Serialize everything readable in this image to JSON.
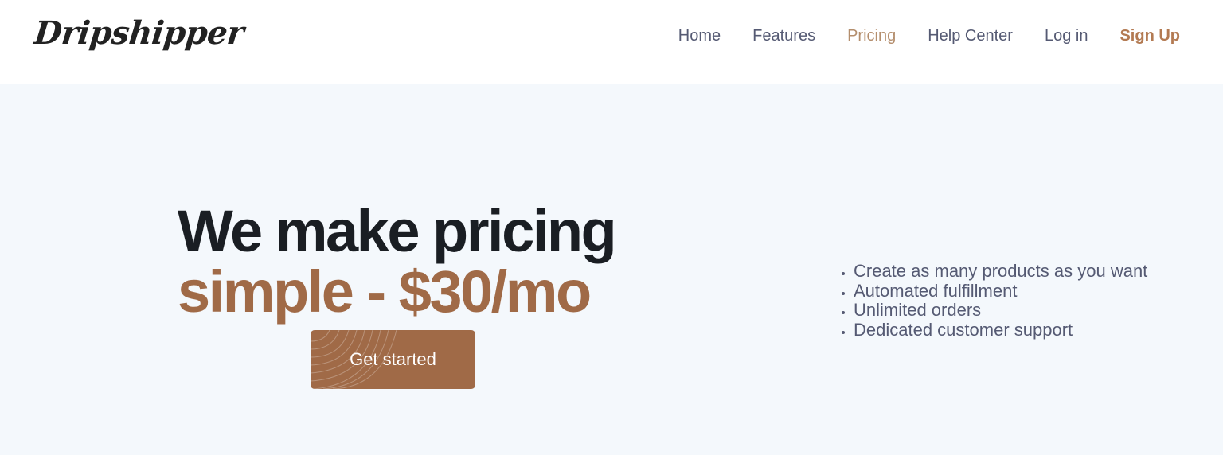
{
  "brand": {
    "name": "Dripshipper"
  },
  "nav": {
    "home": "Home",
    "features": "Features",
    "pricing": "Pricing",
    "help_center": "Help Center",
    "log_in": "Log in",
    "sign_up": "Sign Up",
    "active": "Pricing"
  },
  "hero": {
    "headline_line1": "We make pricing",
    "headline_line2": "simple - $30/mo",
    "cta_label": "Get started",
    "features": [
      "Create as many products as you want",
      "Automated fulfillment",
      "Unlimited orders",
      "Dedicated customer support"
    ]
  },
  "colors": {
    "accent": "#a06a47",
    "nav_active": "#b48e6d",
    "text_dark": "#1a1e23",
    "text_muted": "#555a73",
    "hero_background": "#f4f8fc"
  }
}
